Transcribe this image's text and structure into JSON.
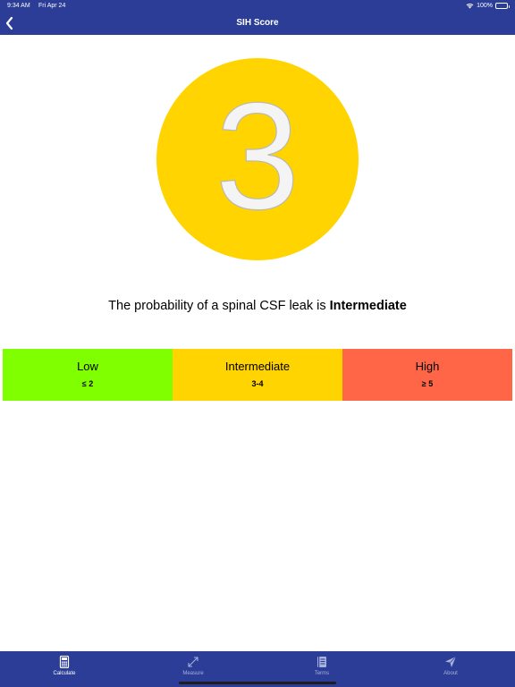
{
  "status_bar": {
    "time": "9:34 AM",
    "date": "Fri Apr 24",
    "battery": "100%",
    "icons": [
      "wifi-icon",
      "battery-icon"
    ]
  },
  "nav": {
    "title": "SIH Score",
    "back_icon": "chevron-left-icon"
  },
  "score": {
    "value": "3",
    "color": "#ffd400"
  },
  "result": {
    "prefix": "The probability of a spinal CSF leak is ",
    "level": "Intermediate"
  },
  "scale": [
    {
      "label": "Low",
      "range": "≤ 2",
      "color": "#80ff00"
    },
    {
      "label": "Intermediate",
      "range": "3-4",
      "color": "#ffd400"
    },
    {
      "label": "High",
      "range": "≥ 5",
      "color": "#ff6647"
    }
  ],
  "tabs": [
    {
      "label": "Calculate",
      "icon": "calculator-icon",
      "active": true
    },
    {
      "label": "Measure",
      "icon": "resize-arrows-icon",
      "active": false
    },
    {
      "label": "Terms",
      "icon": "book-icon",
      "active": false
    },
    {
      "label": "About",
      "icon": "paper-plane-icon",
      "active": false
    }
  ],
  "theme": {
    "bar_color": "#2b3d96",
    "tab_active": "#ffffff",
    "tab_inactive": "#a8b2dc"
  }
}
